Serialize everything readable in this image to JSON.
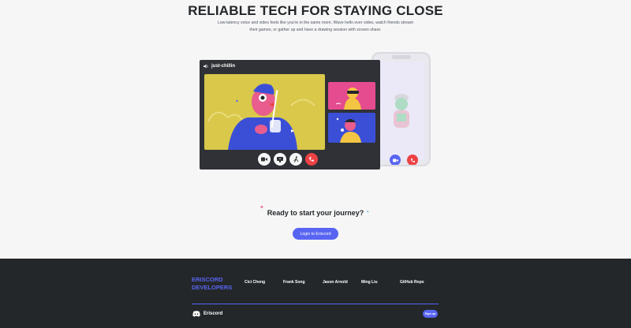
{
  "hero": {
    "title": "RELIABLE TECH FOR STAYING CLOSE",
    "description": "Low-latency voice and video feels like you're in the same room. Wave hello over video, watch friends stream their games, or gather up and have a drawing session with screen share."
  },
  "call_window": {
    "channel_name": "just-chillin",
    "controls": [
      "video-icon",
      "screen-share-icon",
      "activity-icon",
      "hangup-icon"
    ]
  },
  "cta": {
    "title": "Ready to start your journey?",
    "button_label": "Login to Eriscord"
  },
  "footer": {
    "brand_line1": "ERISCORD",
    "brand_line2": "DEVELOPERS",
    "links": [
      "Cici Cheng",
      "Frank Song",
      "Jason Arnold",
      "Ming Liu",
      "GitHub Repo"
    ],
    "logo_text": "Eriscord",
    "signup_label": "Sign up"
  },
  "colors": {
    "accent": "#5865f2",
    "danger": "#ed4245",
    "footer_bg": "#23272a",
    "window_bg": "#2f3136"
  }
}
